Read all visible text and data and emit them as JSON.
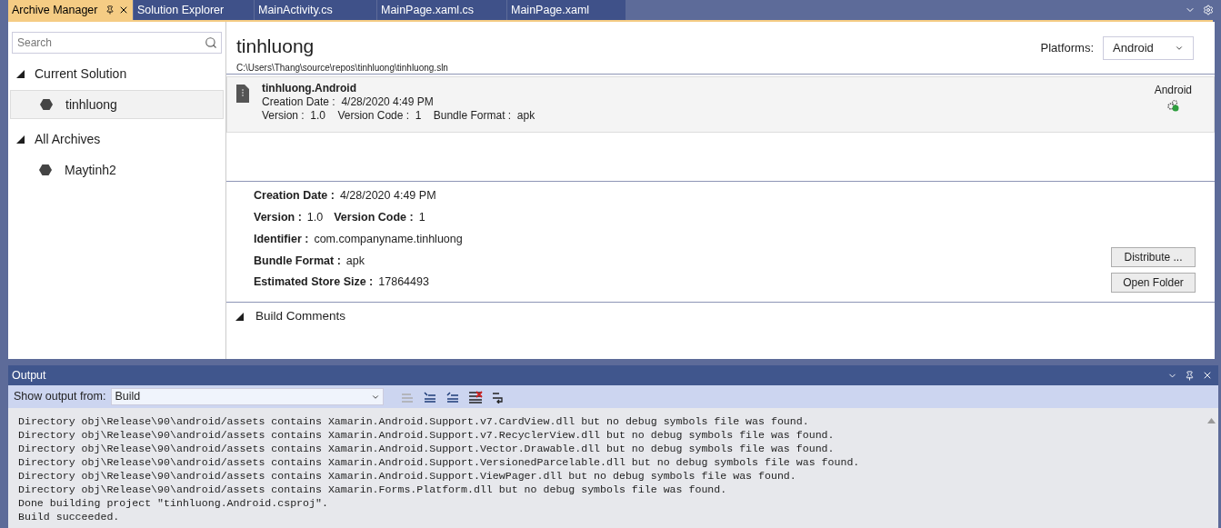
{
  "doc_tabs": [
    {
      "label": "Archive Manager",
      "selected": true
    },
    {
      "label": "Solution Explorer",
      "selected": false
    },
    {
      "label": "MainActivity.cs",
      "selected": false
    },
    {
      "label": "MainPage.xaml.cs",
      "selected": false
    },
    {
      "label": "MainPage.xaml",
      "selected": false
    }
  ],
  "sidebar": {
    "search": {
      "placeholder": "Search"
    },
    "groups": [
      {
        "label": "Current Solution",
        "expanded": true,
        "children": [
          {
            "label": "tinhluong",
            "selected": true
          }
        ]
      },
      {
        "label": "All Archives",
        "expanded": true,
        "children": [
          {
            "label": "Maytinh2",
            "selected": false
          }
        ]
      }
    ]
  },
  "header": {
    "title": "tinhluong",
    "path": "C:\\Users\\Thang\\source\\repos\\tinhluong\\tinhluong.sln",
    "platforms_label": "Platforms:",
    "platform": "Android"
  },
  "archives": [
    {
      "name": "tinhluong.Android",
      "creation": "Creation Date :  4/28/2020 4:49 PM",
      "details": "Version :  1.0    Version Code :  1    Bundle Format :  apk",
      "platform": "Android",
      "selected": true
    }
  ],
  "details": [
    [
      {
        "label": "Creation Date :",
        "value": "4/28/2020 4:49 PM"
      }
    ],
    [
      {
        "label": "Version :",
        "value": "1.0"
      },
      {
        "label": "Version Code :",
        "value": "1"
      }
    ],
    [
      {
        "label": "Identifier :",
        "value": "com.companyname.tinhluong"
      }
    ],
    [
      {
        "label": "Bundle Format :",
        "value": "apk"
      }
    ],
    [
      {
        "label": "Estimated Store Size :",
        "value": "17864493"
      }
    ]
  ],
  "buttons": [
    "Distribute ...",
    "Open Folder"
  ],
  "build_comments": {
    "label": "Build Comments",
    "expanded": true
  },
  "output": {
    "title": "Output",
    "show_from_label": "Show output from:",
    "source": "Build",
    "lines": [
      "Directory obj\\Release\\90\\android/assets contains Xamarin.Android.Support.v7.CardView.dll but no debug symbols file was found.",
      "Directory obj\\Release\\90\\android/assets contains Xamarin.Android.Support.v7.RecyclerView.dll but no debug symbols file was found.",
      "Directory obj\\Release\\90\\android/assets contains Xamarin.Android.Support.Vector.Drawable.dll but no debug symbols file was found.",
      "Directory obj\\Release\\90\\android/assets contains Xamarin.Android.Support.VersionedParcelable.dll but no debug symbols file was found.",
      "Directory obj\\Release\\90\\android/assets contains Xamarin.Android.Support.ViewPager.dll but no debug symbols file was found.",
      "Directory obj\\Release\\90\\android/assets contains Xamarin.Forms.Platform.dll but no debug symbols file was found.",
      "Done building project \"tinhluong.Android.csproj\".",
      "Build succeeded."
    ]
  }
}
